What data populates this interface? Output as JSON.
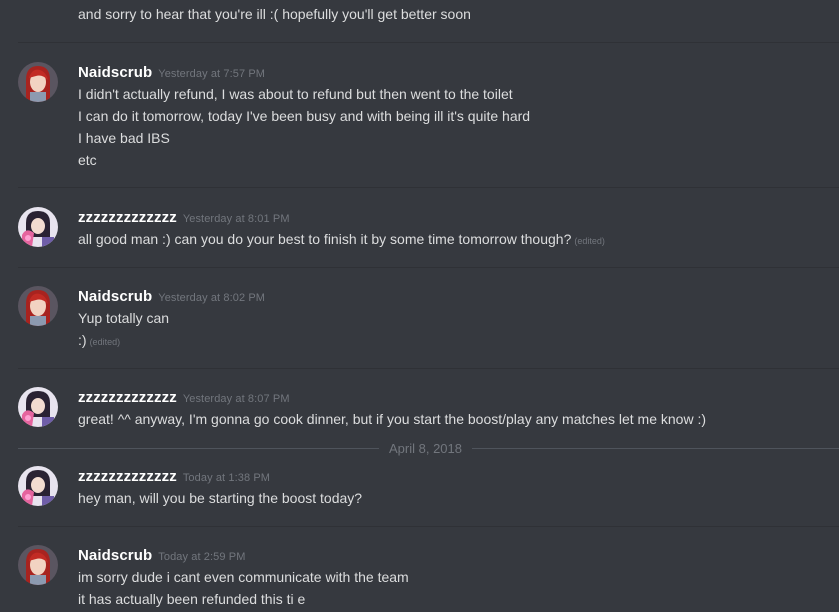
{
  "messages": [
    {
      "lines": [
        "and sorry to hear that you're ill :( hopefully you'll get better soon"
      ]
    },
    {
      "author": "Naidscrub",
      "timestamp": "Yesterday at 7:57 PM",
      "lines": [
        "I didn't actually refund, I was about to refund but then went to the toilet",
        "I can do it tomorrow, today I've been busy and with being ill it's quite hard",
        "I have bad IBS",
        "etc"
      ]
    },
    {
      "author": "zzzzzzzzzzzzz",
      "timestamp": "Yesterday at 8:01 PM",
      "lines": [
        "all good man :) can you do your best to finish it by some time tomorrow though?"
      ],
      "edited": "(edited)"
    },
    {
      "author": "Naidscrub",
      "timestamp": "Yesterday at 8:02 PM",
      "lines": [
        "Yup totally can",
        ":)"
      ],
      "edited": "(edited)"
    },
    {
      "author": "zzzzzzzzzzzzz",
      "timestamp": "Yesterday at 8:07 PM",
      "lines": [
        "great! ^^ anyway, I'm gonna go cook dinner, but if you start the boost/play any matches let me know :)"
      ]
    },
    {
      "author": "zzzzzzzzzzzzz",
      "timestamp": "Today at 1:38 PM",
      "lines": [
        "hey man, will you be starting the boost today?"
      ]
    },
    {
      "author": "Naidscrub",
      "timestamp": "Today at 2:59 PM",
      "lines": [
        "im sorry dude i cant even communicate with the team",
        "it has actually been refunded this ti e"
      ]
    }
  ],
  "date_separator": "April 8, 2018",
  "colors": {
    "background": "#36393f",
    "username": "#ffffff",
    "timestamp": "#72767d",
    "text": "#dcddde"
  }
}
